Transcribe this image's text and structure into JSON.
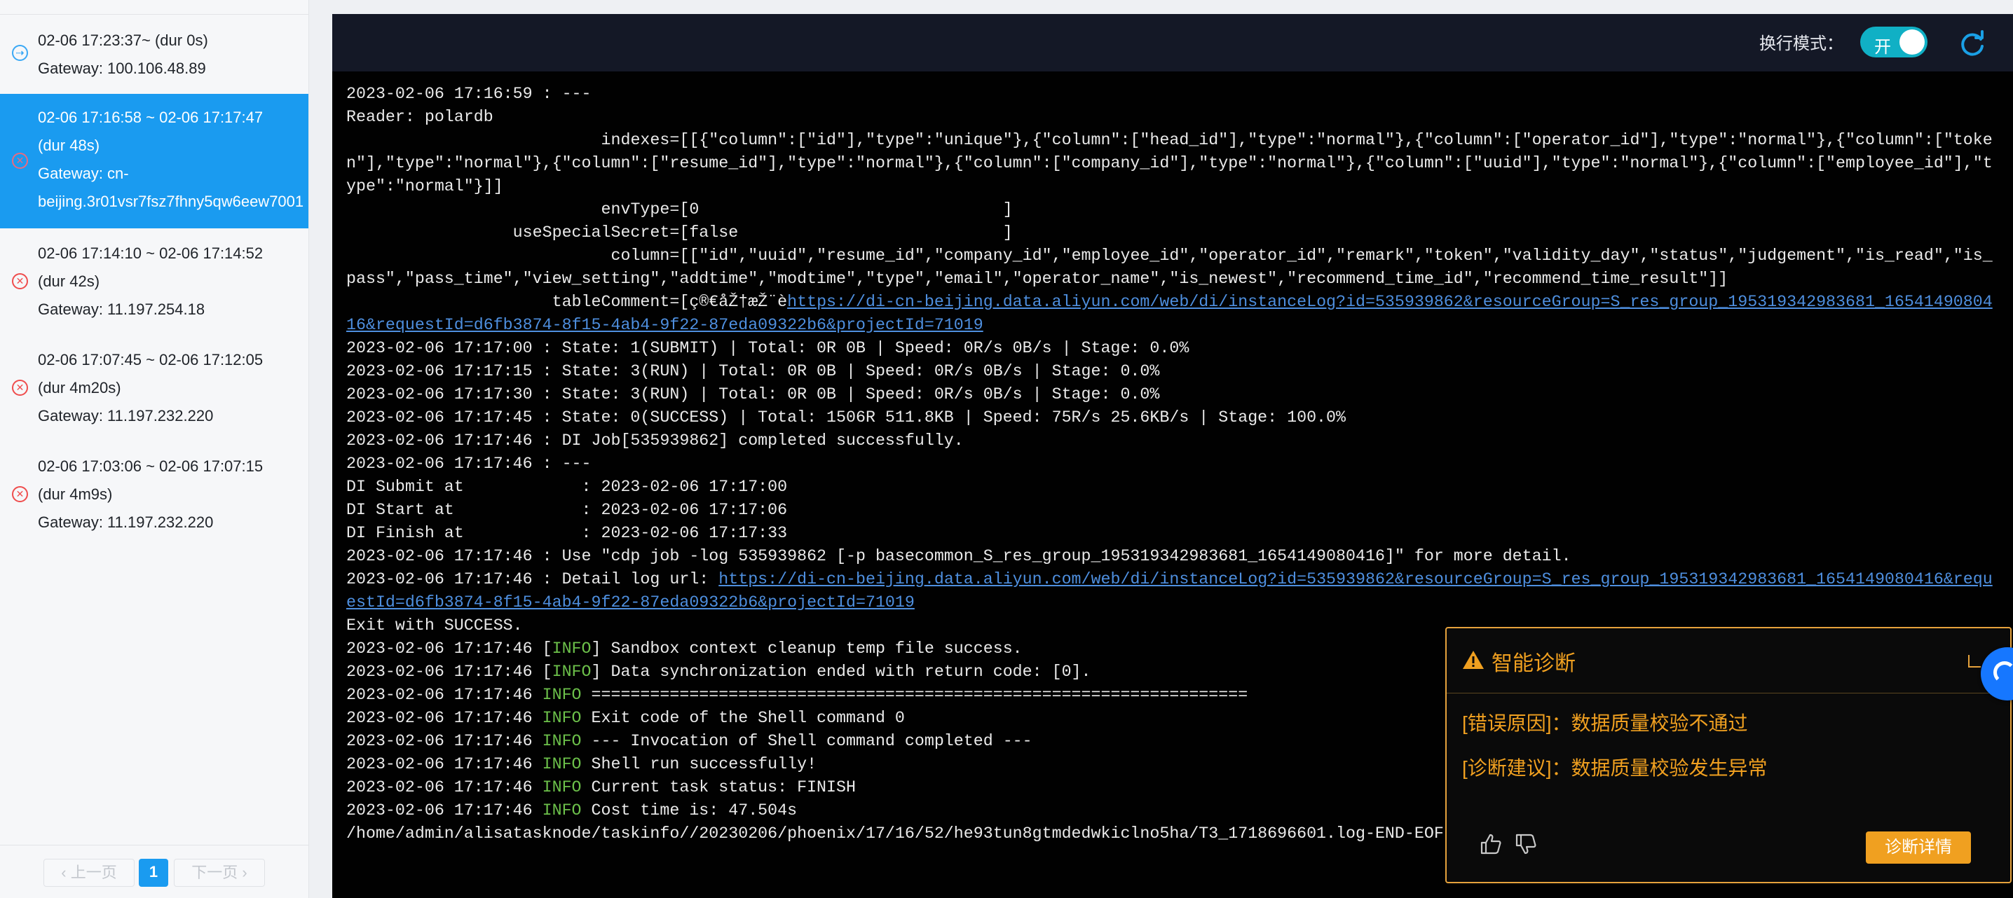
{
  "sidebar": {
    "runs": [
      {
        "status": "running",
        "time": "02-06 17:23:37~ (dur 0s)",
        "duration": "",
        "gateway": "Gateway: 100.106.48.89",
        "active": false
      },
      {
        "status": "failed",
        "time": "02-06 17:16:58 ~ 02-06 17:17:47",
        "duration": "(dur 48s)",
        "gateway": "Gateway: cn-",
        "gateway2": "beijing.3r01vsr7fsz7fhny5qw6eew7001",
        "active": true
      },
      {
        "status": "failed",
        "time": "02-06 17:14:10 ~ 02-06 17:14:52",
        "duration": "(dur 42s)",
        "gateway": "Gateway: 11.197.254.18",
        "active": false
      },
      {
        "status": "failed",
        "time": "02-06 17:07:45 ~ 02-06 17:12:05",
        "duration": "(dur 4m20s)",
        "gateway": "Gateway: 11.197.232.220",
        "active": false
      },
      {
        "status": "failed",
        "time": "02-06 17:03:06 ~ 02-06 17:07:15",
        "duration": "(dur 4m9s)",
        "gateway": "Gateway: 11.197.232.220",
        "active": false
      }
    ],
    "pagination": {
      "prev": "上一页",
      "current": "1",
      "next": "下一页"
    }
  },
  "toolbar": {
    "wrap_label": "换行模式：",
    "wrap_toggle": "开",
    "refresh_icon": "refresh-icon"
  },
  "log": {
    "lines": [
      {
        "t": "2023-02-06 17:16:59 : ---"
      },
      {
        "t": "Reader: polardb"
      },
      {
        "t": "                          indexes=[[{\"column\":[\"id\"],\"type\":\"unique\"},{\"column\":[\"head_id\"],\"type\":\"normal\"},{\"column\":[\"operator_id\"],\"type\":\"normal\"},{\"column\":[\"token\"],\"type\":\"normal\"},{\"column\":[\"resume_id\"],\"type\":\"normal\"},{\"column\":[\"company_id\"],\"type\":\"normal\"},{\"column\":[\"uuid\"],\"type\":\"normal\"},{\"column\":[\"employee_id\"],\"type\":\"normal\"}]]"
      },
      {
        "t": "                          envType=[0                               ]"
      },
      {
        "t": "                 useSpecialSecret=[false                           ]"
      },
      {
        "t": "                           column=[[\"id\",\"uuid\",\"resume_id\",\"company_id\",\"employee_id\",\"operator_id\",\"remark\",\"token\",\"validity_day\",\"status\",\"judgement\",\"is_read\",\"is_pass\",\"pass_time\",\"view_setting\",\"addtime\",\"modtime\",\"type\",\"email\",\"operator_name\",\"is_newest\",\"recommend_time_id\",\"recommend_time_result\"]]"
      },
      {
        "t": "                     tableComment=[ç®€åŽ†æŽ¨è",
        "link": "https://di-cn-beijing.data.aliyun.com/web/di/instanceLog?id=535939862&resourceGroup=S_res_group_195319342983681_1654149080416&requestId=d6fb3874-8f15-4ab4-9f22-87eda09322b6&projectId=71019"
      },
      {
        "t": "2023-02-06 17:17:00 : State: 1(SUBMIT) | Total: 0R 0B | Speed: 0R/s 0B/s | Stage: 0.0%"
      },
      {
        "t": "2023-02-06 17:17:15 : State: 3(RUN) | Total: 0R 0B | Speed: 0R/s 0B/s | Stage: 0.0%"
      },
      {
        "t": "2023-02-06 17:17:30 : State: 3(RUN) | Total: 0R 0B | Speed: 0R/s 0B/s | Stage: 0.0%"
      },
      {
        "t": "2023-02-06 17:17:45 : State: 0(SUCCESS) | Total: 1506R 511.8KB | Speed: 75R/s 25.6KB/s | Stage: 100.0%"
      },
      {
        "t": "2023-02-06 17:17:46 : DI Job[535939862] completed successfully."
      },
      {
        "t": "2023-02-06 17:17:46 : ---"
      },
      {
        "t": "DI Submit at            : 2023-02-06 17:17:00"
      },
      {
        "t": "DI Start at             : 2023-02-06 17:17:06"
      },
      {
        "t": "DI Finish at            : 2023-02-06 17:17:33"
      },
      {
        "t": "2023-02-06 17:17:46 : Use \"cdp job -log 535939862 [-p basecommon_S_res_group_195319342983681_1654149080416]\" for more detail."
      },
      {
        "t": "2023-02-06 17:17:46 : Detail log url: ",
        "link": "https://di-cn-beijing.data.aliyun.com/web/di/instanceLog?id=535939862&resourceGroup=S_res_group_195319342983681_1654149080416&requestId=d6fb3874-8f15-4ab4-9f22-87eda09322b6&projectId=71019"
      },
      {
        "t": "Exit with SUCCESS."
      },
      {
        "t": "2023-02-06 17:17:46 [",
        "info": "INFO",
        "rest": "] Sandbox context cleanup temp file success."
      },
      {
        "t": "2023-02-06 17:17:46 [",
        "info": "INFO",
        "rest": "] Data synchronization ended with return code: [0]."
      },
      {
        "t": "2023-02-06 17:17:46 ",
        "info": "INFO",
        "rest": " ==================================================================="
      },
      {
        "t": "2023-02-06 17:17:46 ",
        "info": "INFO",
        "rest": " Exit code of the Shell command 0"
      },
      {
        "t": "2023-02-06 17:17:46 ",
        "info": "INFO",
        "rest": " --- Invocation of Shell command completed ---"
      },
      {
        "t": "2023-02-06 17:17:46 ",
        "info": "INFO",
        "rest": " Shell run successfully!"
      },
      {
        "t": "2023-02-06 17:17:46 ",
        "info": "INFO",
        "rest": " Current task status: FINISH"
      },
      {
        "t": "2023-02-06 17:17:46 ",
        "info": "INFO",
        "rest": " Cost time is: 47.504s"
      },
      {
        "t": "/home/admin/alisatasknode/taskinfo//20230206/phoenix/17/16/52/he93tun8gtmdedwkiclno5ha/T3_1718696601.log-END-EOF"
      }
    ]
  },
  "diagnosis": {
    "title": "智能诊断",
    "error_cause": "[错误原因]：数据质量校验不通过",
    "suggestion": "[诊断建议]：数据质量校验发生异常",
    "detail_button": "诊断详情",
    "colors": {
      "accent": "#f0a020"
    }
  }
}
